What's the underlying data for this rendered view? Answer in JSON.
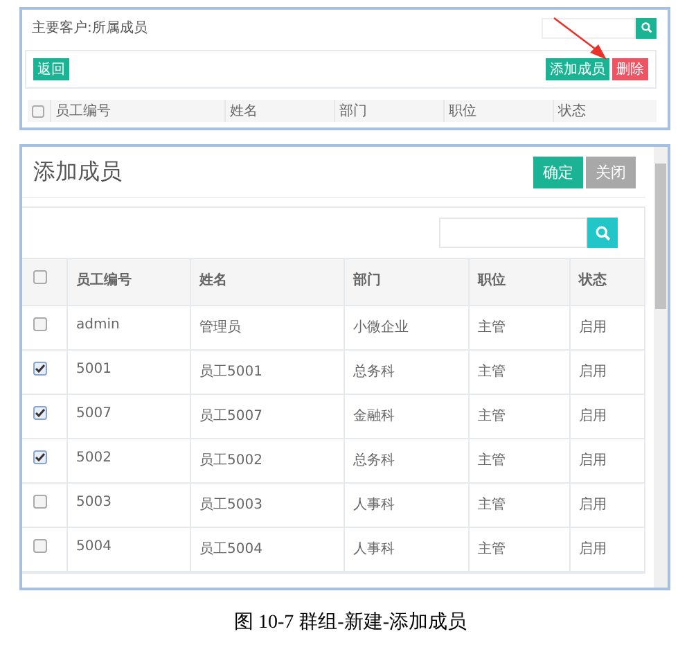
{
  "top_panel": {
    "title": "主要客户:所属成员",
    "buttons": [
      {
        "label": "返回",
        "kind": "back"
      },
      {
        "label": "添加成员",
        "kind": "add"
      },
      {
        "label": "删除",
        "kind": "delete"
      }
    ],
    "header_checkbox": {
      "checked": false
    },
    "columns": [
      "员工编号",
      "姓名",
      "部门",
      "职位",
      "状态"
    ]
  },
  "dialog": {
    "title": "添加成员",
    "buttons": [
      {
        "label": "确定",
        "disabled": false
      },
      {
        "label": "关闭",
        "disabled": true
      }
    ],
    "header_checkbox": {
      "checked": false
    },
    "columns": [
      "员工编号",
      "姓名",
      "部门",
      "职位",
      "状态"
    ],
    "rows": [
      {
        "checked": false,
        "cells": [
          "admin",
          "管理员",
          "小微企业",
          "主管",
          "启用"
        ]
      },
      {
        "checked": true,
        "cells": [
          "5001",
          "员工5001",
          "总务科",
          "主管",
          "启用"
        ]
      },
      {
        "checked": true,
        "cells": [
          "5007",
          "员工5007",
          "金融科",
          "主管",
          "启用"
        ]
      },
      {
        "checked": true,
        "cells": [
          "5002",
          "员工5002",
          "总务科",
          "主管",
          "启用"
        ]
      },
      {
        "checked": false,
        "cells": [
          "5003",
          "员工5003",
          "人事科",
          "主管",
          "启用"
        ]
      },
      {
        "checked": false,
        "cells": [
          "5004",
          "员工5004",
          "人事科",
          "主管",
          "启用"
        ]
      }
    ]
  },
  "caption": "图 10-7  群组-新建-添加成员"
}
